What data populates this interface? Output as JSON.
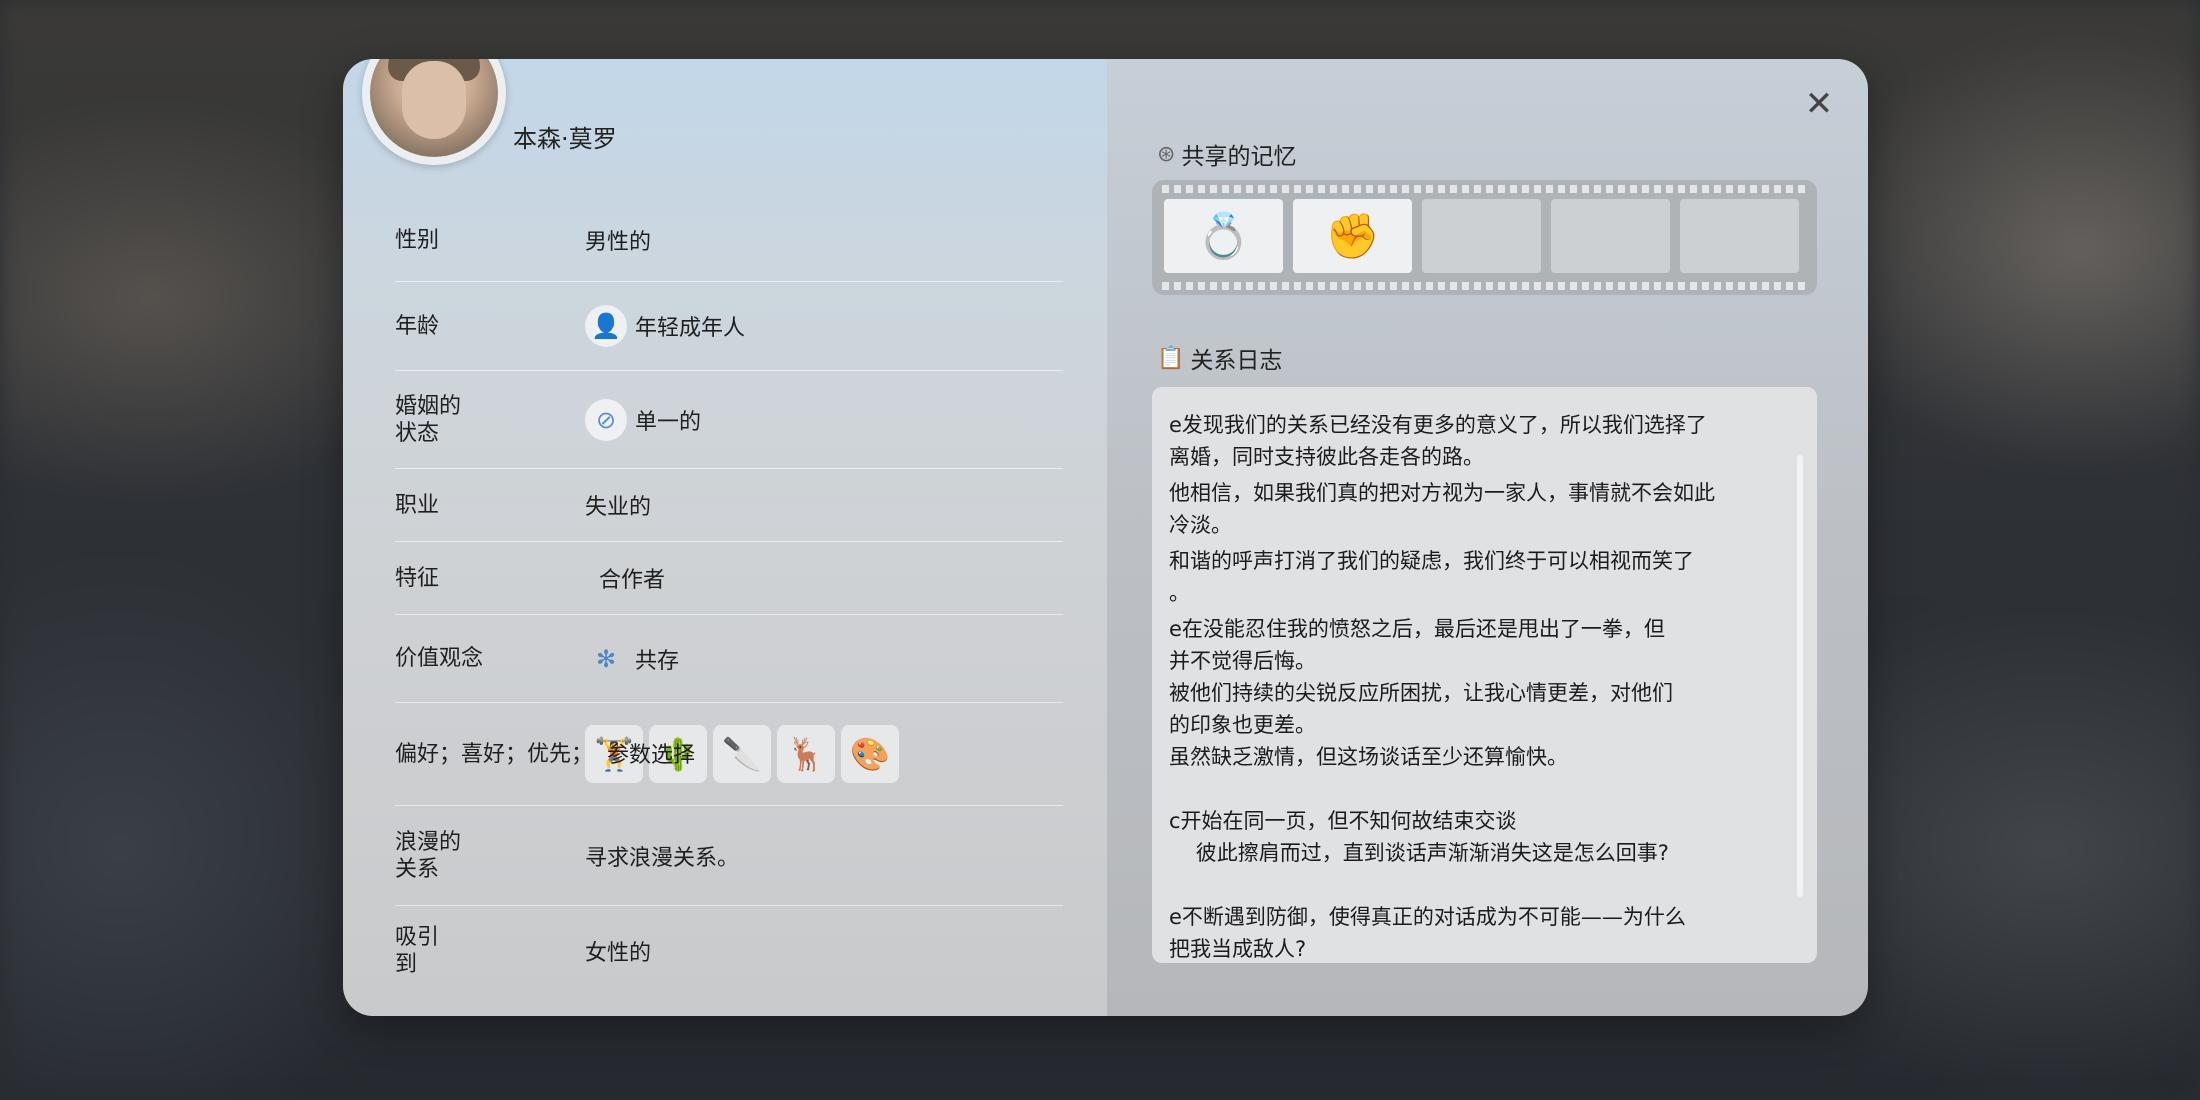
{
  "profile": {
    "name": "本森·莫罗",
    "rows": [
      {
        "label": "性别",
        "value": "男性的"
      },
      {
        "label": "年龄",
        "value": "年轻成年人",
        "icon": "young-adult-icon"
      },
      {
        "label": "婚姻的\n状态",
        "value": "单一的",
        "icon": "single-status-icon"
      },
      {
        "label": "职业",
        "value": "失业的"
      },
      {
        "label": "特征",
        "value": "合作者"
      },
      {
        "label": "价值观念",
        "value": "共存",
        "icon": "coexist-icon"
      },
      {
        "label": "偏好；喜好；优先；",
        "value": "参数选择"
      },
      {
        "label": "浪漫的\n关系",
        "value": "寻求浪漫关系。"
      },
      {
        "label": "吸引\n到",
        "value": "女性的"
      }
    ],
    "preference_chips": [
      "fitness-icon",
      "cactus-icon",
      "knife-icon",
      "deer-icon",
      "palette-icon"
    ]
  },
  "memories": {
    "title": "共享的记忆",
    "frames": [
      {
        "icon": "broken-rings-icon",
        "glyph": "💍"
      },
      {
        "icon": "fist-icon",
        "glyph": "✊"
      },
      {
        "icon": "",
        "glyph": ""
      },
      {
        "icon": "",
        "glyph": ""
      },
      {
        "icon": "",
        "glyph": ""
      }
    ]
  },
  "log": {
    "title": "关系日志",
    "entries": [
      "e发现我们的关系已经没有更多的意义了，所以我们选择了\n离婚，同时支持彼此各走各的路。",
      "他相信，如果我们真的把对方视为一家人，事情就不会如此\n冷淡。",
      "和谐的呼声打消了我们的疑虑，我们终于可以相视而笑了\n。",
      "e在没能忍住我的愤怒之后，最后还是甩出了一拳，但\n并不觉得后悔。",
      "被他们持续的尖锐反应所困扰，让我心情更差，对他们\n的印象也更差。",
      "虽然缺乏激情，但这场谈话至少还算愉快。",
      "",
      "c开始在同一页，但不知何故结束交谈\n    彼此擦肩而过，直到谈话声渐渐消失这是怎么回事?",
      "",
      "e不断遇到防御，使得真正的对话成为不可能——为什么\n把我当成敌人?"
    ]
  },
  "close_label": "✕"
}
